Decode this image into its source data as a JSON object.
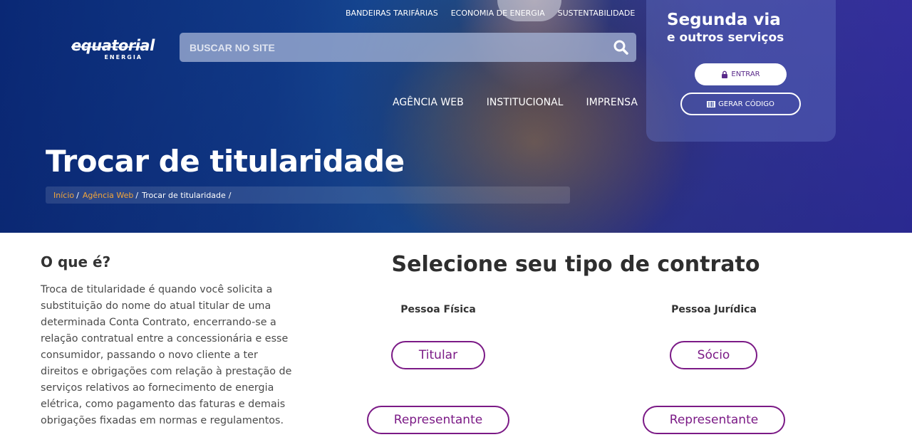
{
  "header": {
    "logo": {
      "wordmark": "equatorial",
      "sub": "ENERGIA"
    },
    "top_links": [
      "BANDEIRAS TARIFÁRIAS",
      "ECONOMIA DE ENERGIA",
      "SUSTENTABILIDADE"
    ],
    "search": {
      "placeholder": "BUSCAR NO SITE",
      "value": ""
    },
    "main_nav": [
      "AGÊNCIA WEB",
      "INSTITUCIONAL",
      "IMPRENSA"
    ]
  },
  "services": {
    "title": "Segunda via",
    "subtitle": "e outros serviços",
    "enter_label": "ENTRAR",
    "generate_label": "GERAR CÓDIGO"
  },
  "page": {
    "title": "Trocar de titularidade",
    "breadcrumb": [
      {
        "label": "Início",
        "link": true
      },
      {
        "label": "Agência Web",
        "link": true
      },
      {
        "label": "Trocar de titularidade",
        "link": false
      }
    ]
  },
  "about": {
    "heading": "O que é?",
    "text": "Troca de titularidade é quando você solicita a substituição do nome do atual titular de uma determinada Conta Contrato, encerrando-se a relação contratual entre a concessionária e esse consumidor, passando o novo cliente a ter direitos e obrigações com relação à prestação de serviços relativos ao fornecimento de energia elétrica, como pagamento das faturas e demais obrigações fixadas em normas e regulamentos."
  },
  "contract": {
    "title": "Selecione seu tipo de contrato",
    "pessoa_fisica": {
      "label": "Pessoa Física",
      "options": [
        "Titular",
        "Representante"
      ]
    },
    "pessoa_juridica": {
      "label": "Pessoa Jurídica",
      "options": [
        "Sócio",
        "Representante"
      ]
    }
  },
  "colors": {
    "accent": "#7b1a86",
    "breadcrumb_link": "#f2a53a",
    "hero_start": "#0a2a78",
    "hero_end": "#3b2fa8"
  },
  "icons": [
    "search-icon",
    "lock-icon",
    "barcode-icon"
  ]
}
